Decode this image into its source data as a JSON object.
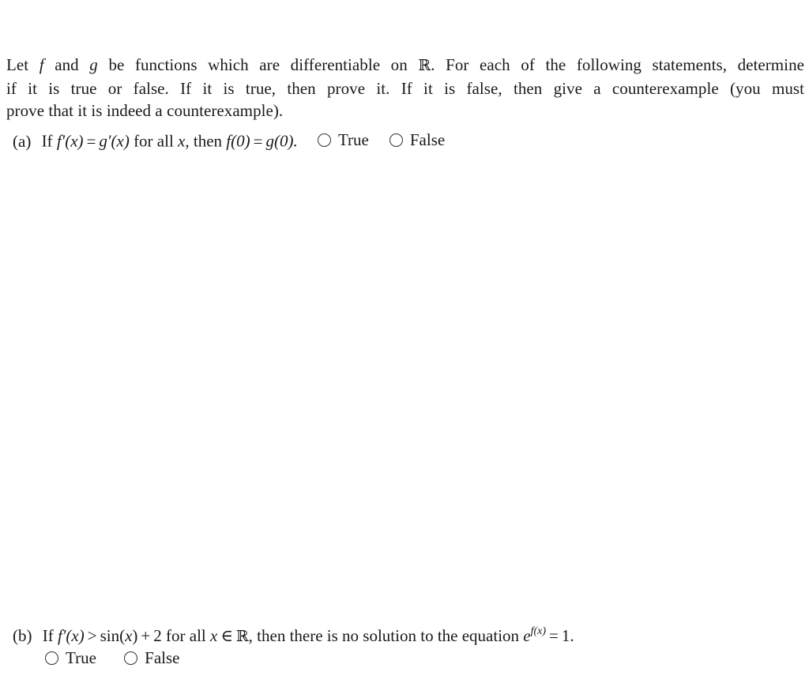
{
  "intro": {
    "line1": "Let f and g be functions which are differentiable on ℝ. For each of the following statements, determine",
    "parts": {
      "let": "Let",
      "f": "f",
      "and": "and",
      "g": "g",
      "rest1": "be functions which are differentiable on",
      "R": "ℝ",
      "rest2": ". For each of the following statements, determine"
    },
    "line2": "if it is true or false.  If it is true, then prove it.  If it is false, then give a counterexample (you must",
    "line3": "prove that it is indeed a counterexample)."
  },
  "questions": [
    {
      "label": "(a)",
      "if": "If",
      "lhs": "f′(x)",
      "eq": "=",
      "rhs": "g′(x)",
      "for_all": "for all",
      "var": "x",
      "comma_then": ", then",
      "concl_lhs": "f(0)",
      "concl_eq": "=",
      "concl_rhs": "g(0).",
      "options": [
        {
          "label": "True",
          "selected": false
        },
        {
          "label": "False",
          "selected": false
        }
      ]
    },
    {
      "label": "(b)",
      "if": "If",
      "lhs": "f′(x)",
      "gt": ">",
      "rhs_fn": "sin(",
      "rhs_var": "x",
      "rhs_close": ")",
      "plus": "+",
      "two": "2",
      "for_all": "for all",
      "var": "x",
      "in": "∈",
      "R": "ℝ",
      "then_text": ", then there is no solution to the equation",
      "e": "e",
      "exp": "f(x)",
      "eq": "=",
      "one": "1.",
      "options": [
        {
          "label": "True",
          "selected": false
        },
        {
          "label": "False",
          "selected": false
        }
      ]
    }
  ]
}
